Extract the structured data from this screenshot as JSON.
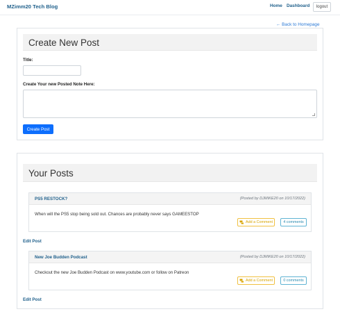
{
  "navbar": {
    "brand": "MZimm20 Tech Blog",
    "home_label": "Home",
    "dashboard_label": "Dashboard",
    "logout_label": "logout"
  },
  "back_link": "← Back to Homepage",
  "create_post": {
    "heading": "Create New Post",
    "title_label": "Title:",
    "title_value": "",
    "note_label": "Create Your new Posted Note Here:",
    "note_value": "",
    "submit_label": "Create Post"
  },
  "your_posts": {
    "heading": "Your Posts",
    "edit_label": "Edit Post",
    "add_comment_label": "Add a Comment",
    "posts": [
      {
        "title": "PS5 RESTOCK?",
        "meta": "(Posted by DJMIKE20 on 10/17/2022)",
        "body": "When will the PS5 stop being sold out. Chances are probably never says GAMEESTOP",
        "comments_count": "4 comments"
      },
      {
        "title": "New Joe Budden Podcast",
        "meta": "(Posted by DJMIKE20 on 10/17/2022)",
        "body": "Checkout the new Joe Budden Podcast on www.youtube.com or follow on Patreon",
        "comments_count": "0 comments"
      }
    ]
  },
  "colors": {
    "primary": "#0d6efd",
    "link": "#21618c",
    "warning": "#f0c040",
    "info": "#5fb3d3"
  }
}
